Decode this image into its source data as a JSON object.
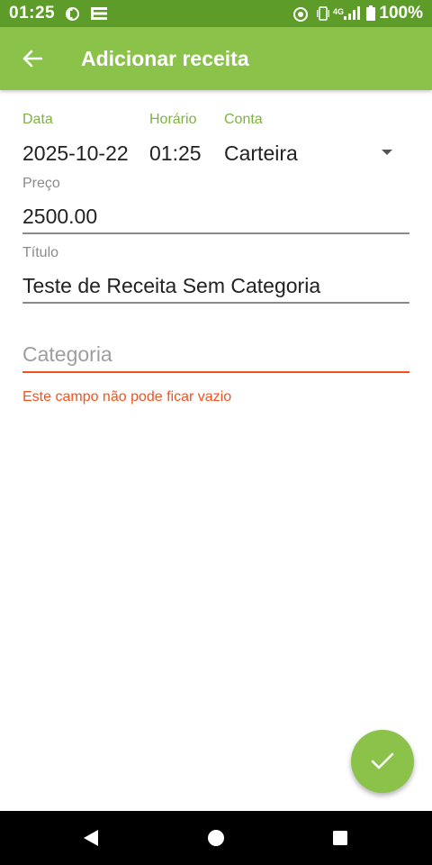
{
  "status_bar": {
    "time": "01:25",
    "battery": "100%",
    "network": "4G",
    "icons": [
      "sync-icon",
      "notification-icon",
      "alarm-icon",
      "vibrate-icon",
      "signal-icon",
      "battery-icon"
    ]
  },
  "app_bar": {
    "title": "Adicionar receita",
    "back_icon": "arrow-back-icon"
  },
  "form": {
    "date": {
      "label": "Data",
      "value": "2025-10-22"
    },
    "time": {
      "label": "Horário",
      "value": "01:25"
    },
    "account": {
      "label": "Conta",
      "value": "Carteira"
    },
    "price": {
      "label": "Preço",
      "value": "2500.00"
    },
    "title": {
      "label": "Título",
      "value": "Teste de Receita Sem Categoria"
    },
    "category": {
      "placeholder": "Categoria",
      "error": "Este campo não pode ficar vazio"
    }
  },
  "fab": {
    "icon": "check-icon"
  },
  "nav_bar": {
    "icons": [
      "back-triangle-icon",
      "home-circle-icon",
      "recents-square-icon"
    ]
  },
  "colors": {
    "status_bar": "#5e9c2a",
    "primary": "#8bc34a",
    "label": "#7cb342",
    "error": "#f4511e"
  }
}
